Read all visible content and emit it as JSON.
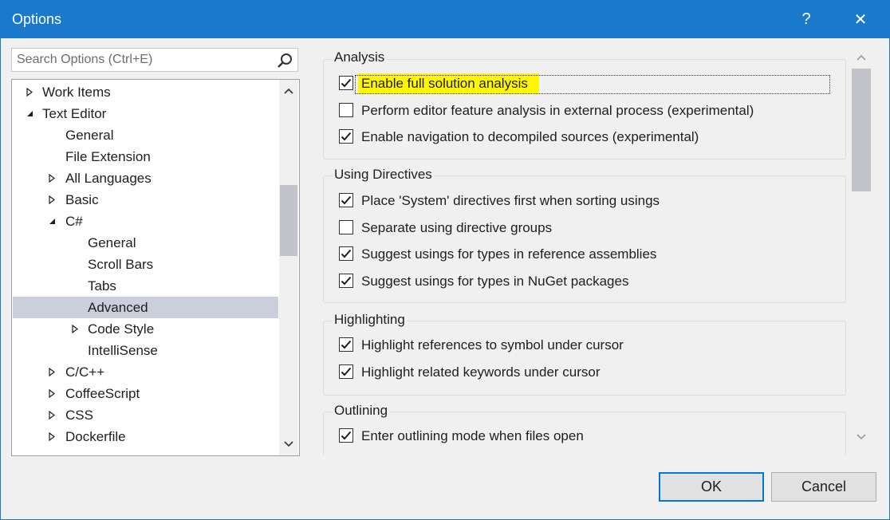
{
  "window": {
    "title": "Options",
    "help_glyph": "?",
    "close_glyph": "✕"
  },
  "search": {
    "placeholder": "Search Options (Ctrl+E)"
  },
  "tree": {
    "items": [
      {
        "label": "Work Items",
        "level": 0,
        "arrow": "collapsed"
      },
      {
        "label": "Text Editor",
        "level": 0,
        "arrow": "expanded"
      },
      {
        "label": "General",
        "level": 1,
        "arrow": "none"
      },
      {
        "label": "File Extension",
        "level": 1,
        "arrow": "none"
      },
      {
        "label": "All Languages",
        "level": 1,
        "arrow": "collapsed"
      },
      {
        "label": "Basic",
        "level": 1,
        "arrow": "collapsed"
      },
      {
        "label": "C#",
        "level": 1,
        "arrow": "expanded"
      },
      {
        "label": "General",
        "level": 2,
        "arrow": "none"
      },
      {
        "label": "Scroll Bars",
        "level": 2,
        "arrow": "none"
      },
      {
        "label": "Tabs",
        "level": 2,
        "arrow": "none"
      },
      {
        "label": "Advanced",
        "level": 2,
        "arrow": "none",
        "selected": true
      },
      {
        "label": "Code Style",
        "level": 2,
        "arrow": "collapsed"
      },
      {
        "label": "IntelliSense",
        "level": 2,
        "arrow": "none"
      },
      {
        "label": "C/C++",
        "level": 1,
        "arrow": "collapsed"
      },
      {
        "label": "CoffeeScript",
        "level": 1,
        "arrow": "collapsed"
      },
      {
        "label": "CSS",
        "level": 1,
        "arrow": "collapsed"
      },
      {
        "label": "Dockerfile",
        "level": 1,
        "arrow": "collapsed"
      }
    ]
  },
  "groups": {
    "analysis": {
      "title": "Analysis",
      "options": [
        {
          "label": "Enable full solution analysis",
          "checked": true,
          "highlighted": true
        },
        {
          "label": "Perform editor feature analysis in external process (experimental)",
          "checked": false
        },
        {
          "label": "Enable navigation to decompiled sources (experimental)",
          "checked": true
        }
      ]
    },
    "using_directives": {
      "title": "Using Directives",
      "options": [
        {
          "label": "Place 'System' directives first when sorting usings",
          "checked": true
        },
        {
          "label": "Separate using directive groups",
          "checked": false
        },
        {
          "label": "Suggest usings for types in reference assemblies",
          "checked": true
        },
        {
          "label": "Suggest usings for types in NuGet packages",
          "checked": true
        }
      ]
    },
    "highlighting": {
      "title": "Highlighting",
      "options": [
        {
          "label": "Highlight references to symbol under cursor",
          "checked": true
        },
        {
          "label": "Highlight related keywords under cursor",
          "checked": true
        }
      ]
    },
    "outlining": {
      "title": "Outlining",
      "options": [
        {
          "label": "Enter outlining mode when files open",
          "checked": true
        }
      ]
    }
  },
  "buttons": {
    "ok": "OK",
    "cancel": "Cancel"
  },
  "colors": {
    "titlebar": "#1979ca",
    "selection": "#cbcfdc",
    "highlight": "#fff700",
    "ok_border": "#0078d7"
  },
  "icons": {
    "search": "search-icon",
    "close": "close-icon",
    "help": "help-icon",
    "check": "checkmark-icon"
  }
}
